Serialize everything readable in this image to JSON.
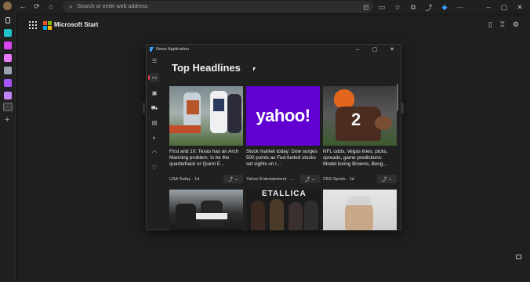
{
  "browser": {
    "address_placeholder": "Search or enter web address"
  },
  "sidebar_tiles": [
    {
      "color": "#ffffff"
    },
    {
      "color": "#1fc3c9"
    },
    {
      "color": "#d946ef"
    },
    {
      "color": "#e879f9"
    },
    {
      "color": "#9ca3af"
    },
    {
      "color": "#a855f7"
    },
    {
      "color": "#c084fc"
    },
    {
      "color": "#7c3aed"
    }
  ],
  "page": {
    "brand_title": "Microsoft Start",
    "icons": [
      "phone-icon",
      "trophy-icon",
      "gear-icon"
    ]
  },
  "app": {
    "window_title": "News Application",
    "heading": "Top Headlines",
    "nav_icons": [
      "menu-icon",
      "news-icon",
      "photo-icon",
      "car-icon",
      "film-icon",
      "sports-icon",
      "game-icon",
      "heart-icon"
    ],
    "cards": [
      {
        "title": "First and 10: Texas has an Arch Manning problem. Is he the quarterback or Quinn E...",
        "source": "USA Today · 1d"
      },
      {
        "title": "Stock market today: Dow surges 500 points as Fed-fueled stocks set sights on r...",
        "source": "Yahoo Entertainment · ..."
      },
      {
        "title": "NFL odds, Vegas lines, picks, spreads, game predictions: Model loving Browns, Beng...",
        "source": "CBS Sports · 1d"
      }
    ],
    "yahoo_logo": "yahoo!",
    "metallica_text": "ETALLICA",
    "jersey_number": "2"
  }
}
